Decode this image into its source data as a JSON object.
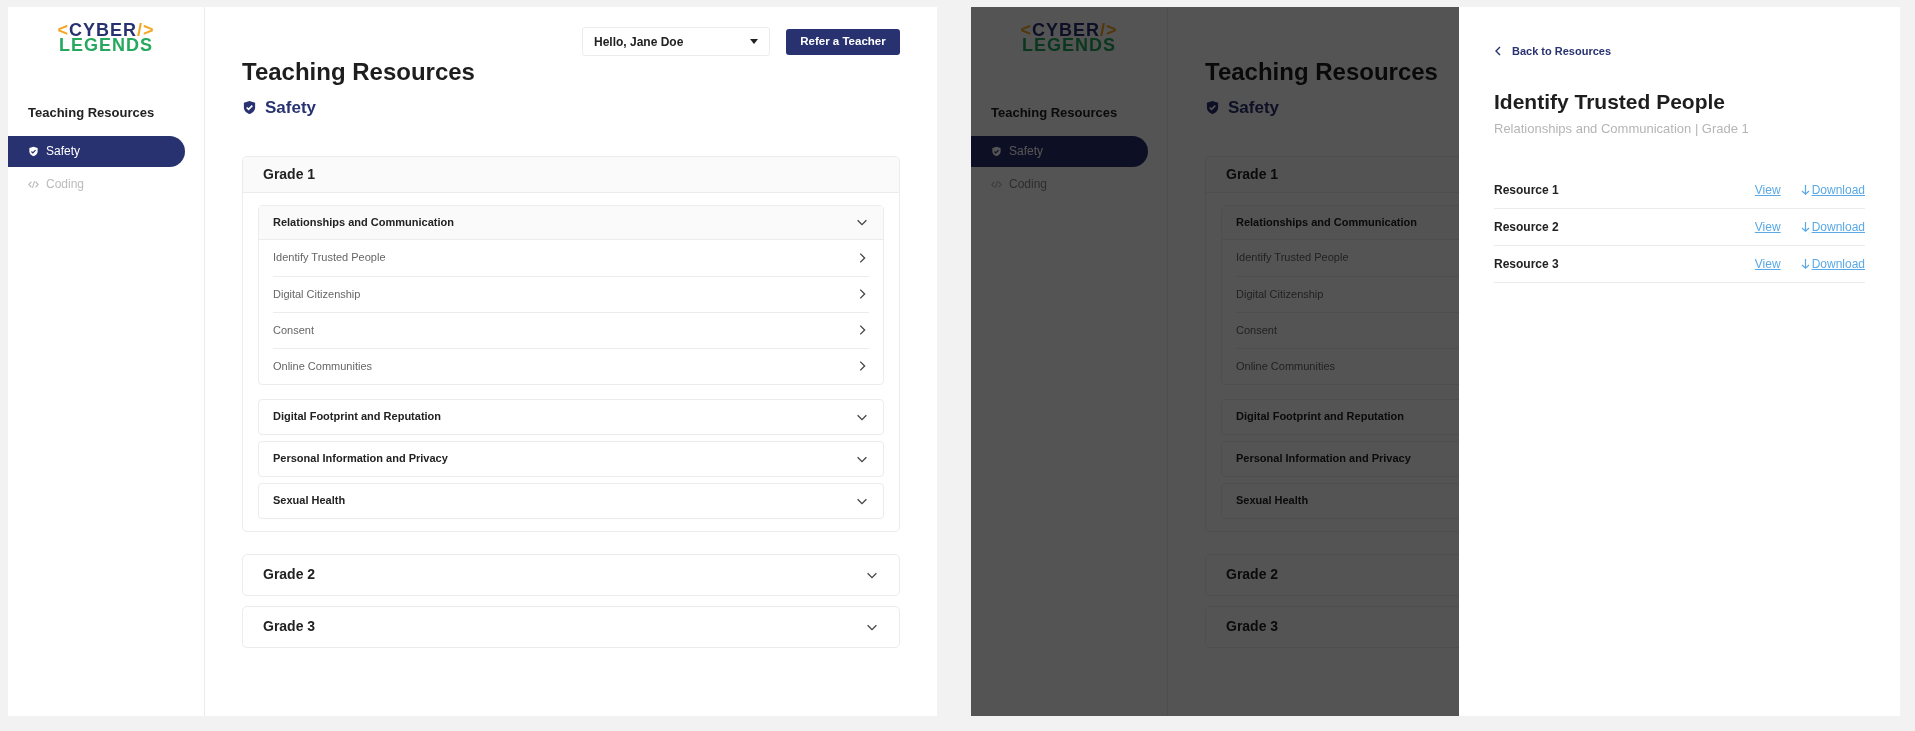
{
  "screens": [
    {
      "logo": {
        "open": "<",
        "word": "CYBER",
        "close": "/>",
        "second": "LEGENDS"
      },
      "sidebar": {
        "heading": "Teaching Resources",
        "items": [
          {
            "label": "Safety",
            "kind": "shield",
            "selected": true
          },
          {
            "label": "Coding",
            "kind": "code",
            "selected": false
          }
        ]
      },
      "header": {
        "user_menu": "Hello, Jane Doe",
        "refer_button": "Refer a Teacher"
      },
      "page": {
        "title": "Teaching Resources",
        "category": "Safety"
      },
      "grades": [
        {
          "label": "Grade 1",
          "expanded": true,
          "topics": [
            {
              "title": "Relationships and Communication",
              "expanded": true,
              "lessons": [
                "Identify Trusted People",
                "Digital Citizenship",
                "Consent",
                "Online Communities"
              ]
            },
            {
              "title": "Digital Footprint and Reputation",
              "expanded": false
            },
            {
              "title": "Personal Information and Privacy",
              "expanded": false
            },
            {
              "title": "Sexual Health",
              "expanded": false
            }
          ]
        },
        {
          "label": "Grade 2",
          "expanded": false
        },
        {
          "label": "Grade 3",
          "expanded": false
        }
      ]
    },
    {
      "logo": {
        "open": "<",
        "word": "CYBER",
        "close": "/>",
        "second": "LEGENDS"
      },
      "sidebar": {
        "heading": "Teaching Resources",
        "items": [
          {
            "label": "Safety",
            "kind": "shield",
            "selected": true
          },
          {
            "label": "Coding",
            "kind": "code",
            "selected": false
          }
        ]
      },
      "page": {
        "title": "Teaching Resources",
        "category": "Safety"
      },
      "grades": [
        {
          "label": "Grade 1",
          "expanded": true,
          "topics": [
            {
              "title": "Relationships and Communication",
              "expanded": true,
              "lessons": [
                "Identify Trusted People",
                "Digital Citizenship",
                "Consent",
                "Online Communities"
              ]
            },
            {
              "title": "Digital Footprint and Reputation",
              "expanded": false
            },
            {
              "title": "Personal Information and Privacy",
              "expanded": false
            },
            {
              "title": "Sexual Health",
              "expanded": false
            }
          ]
        },
        {
          "label": "Grade 2",
          "expanded": false
        },
        {
          "label": "Grade 3",
          "expanded": false
        }
      ],
      "detail_panel": {
        "back_link": "Back to Resources",
        "title": "Identify Trusted People",
        "subtitle": "Relationships and Communication | Grade 1",
        "resources": [
          {
            "name": "Resource 1",
            "view": "View",
            "download": "Download"
          },
          {
            "name": "Resource 2",
            "view": "View",
            "download": "Download"
          },
          {
            "name": "Resource 3",
            "view": "View",
            "download": "Download"
          }
        ]
      }
    }
  ]
}
